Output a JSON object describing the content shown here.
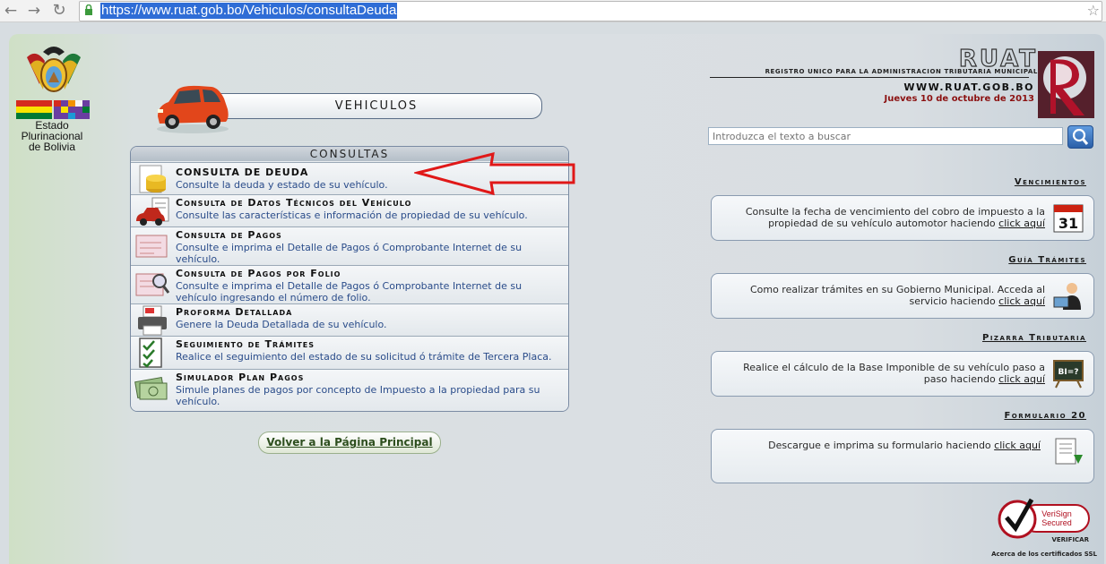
{
  "browser": {
    "url": "https://www.ruat.gob.bo/Vehiculos/consultaDeuda"
  },
  "left": {
    "estado_label": "Estado Plurinacional de Bolivia"
  },
  "header": {
    "title": "VEHICULOS"
  },
  "consultas": {
    "title": "CONSULTAS",
    "items": [
      {
        "title": "CONSULTA DE DEUDA",
        "desc": "Consulte la deuda y estado de su vehículo.",
        "icon": "coins-icon"
      },
      {
        "title": "Consulta de Datos Técnicos del Vehículo",
        "desc": "Consulte las características e información de propiedad de su vehículo.",
        "icon": "car-document-icon"
      },
      {
        "title": "Consulta de Pagos",
        "desc": "Consulte e imprima el Detalle de Pagos ó Comprobante Internet de su vehículo.",
        "icon": "receipt-icon"
      },
      {
        "title": "Consulta de Pagos por Folio",
        "desc": "Consulte e imprima el Detalle de Pagos ó Comprobante Internet de su vehículo ingresando el número de folio.",
        "icon": "magnifier-receipt-icon"
      },
      {
        "title": "Proforma Detallada",
        "desc": "Genere la Deuda Detallada de su vehículo.",
        "icon": "printer-icon"
      },
      {
        "title": "Seguimiento de Trámites",
        "desc": "Realice el seguimiento del estado de su solicitud ó trámite de Tercera Placa.",
        "icon": "checklist-icon"
      },
      {
        "title": "Simulador Plan Pagos",
        "desc": "Simule planes de pagos por concepto de Impuesto a la propiedad para su vehículo.",
        "icon": "money-icon"
      }
    ]
  },
  "volver_label": "Volver a la Página Principal",
  "ruat": {
    "logo_text": "RUAT",
    "subtitle": "REGISTRO UNICO PARA LA ADMINISTRACION TRIBUTARIA MUNICIPAL",
    "website": "WWW.RUAT.GOB.BO",
    "date": "Jueves 10 de octubre de 2013"
  },
  "search": {
    "placeholder": "Introduzca el texto a buscar"
  },
  "sections": [
    {
      "heading": "Vencimientos",
      "text": "Consulte la fecha de vencimiento del cobro de impuesto a la propiedad de su vehículo automotor haciendo",
      "link": "click aquí",
      "icon": "calendar-icon",
      "icon_text": "31"
    },
    {
      "heading": "Guía Trámites",
      "text": "Como realizar trámites en su Gobierno Municipal. Acceda al servicio haciendo",
      "link": "click aquí",
      "icon": "person-computer-icon"
    },
    {
      "heading": "Pizarra Tributaria",
      "text": "Realice el cálculo de la Base Imponible de su vehículo paso a paso haciendo",
      "link": "click aquí",
      "icon": "blackboard-icon",
      "icon_text": "BI=?"
    },
    {
      "heading": "Formulario 20",
      "text": "Descargue e imprima su formulario haciendo",
      "link": "click aquí",
      "icon": "download-form-icon"
    }
  ],
  "verisign": {
    "badge_line1": "VeriSign",
    "badge_line2": "Secured",
    "verify": "VERIFICAR",
    "ssl_note": "Acerca de los certificados SSL"
  },
  "colors": {
    "link_blue": "#2a4c8a",
    "date_red": "#8b1010",
    "arrow_red": "#e01818"
  }
}
